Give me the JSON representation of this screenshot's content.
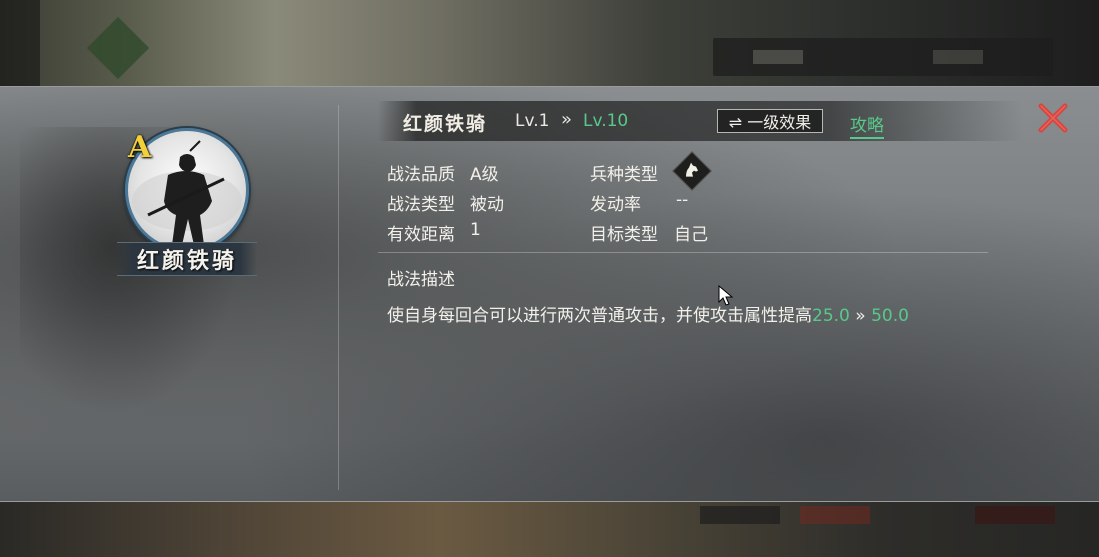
{
  "skill": {
    "name": "红颜铁骑",
    "grade": "A",
    "level_from": "Lv.1",
    "level_arrow": "»",
    "level_to": "Lv.10",
    "effect_button": "⇌ 一级效果",
    "guide_link": "攻略"
  },
  "attributes": {
    "quality_label": "战法品质",
    "quality_value": "A级",
    "troop_label": "兵种类型",
    "troop_icon": "horse-icon",
    "type_label": "战法类型",
    "type_value": "被动",
    "rate_label": "发动率",
    "rate_value": "--",
    "range_label": "有效距离",
    "range_value": "1",
    "target_label": "目标类型",
    "target_value": "自己"
  },
  "description": {
    "title": "战法描述",
    "text": "使自身每回合可以进行两次普通攻击，并使攻击属性提高",
    "value_from": "25.0",
    "arrow": " » ",
    "value_to": "50.0"
  },
  "colors": {
    "accent_green": "#58c98a",
    "grade_gold": "#f3d03a",
    "close_red": "#d8453e"
  }
}
